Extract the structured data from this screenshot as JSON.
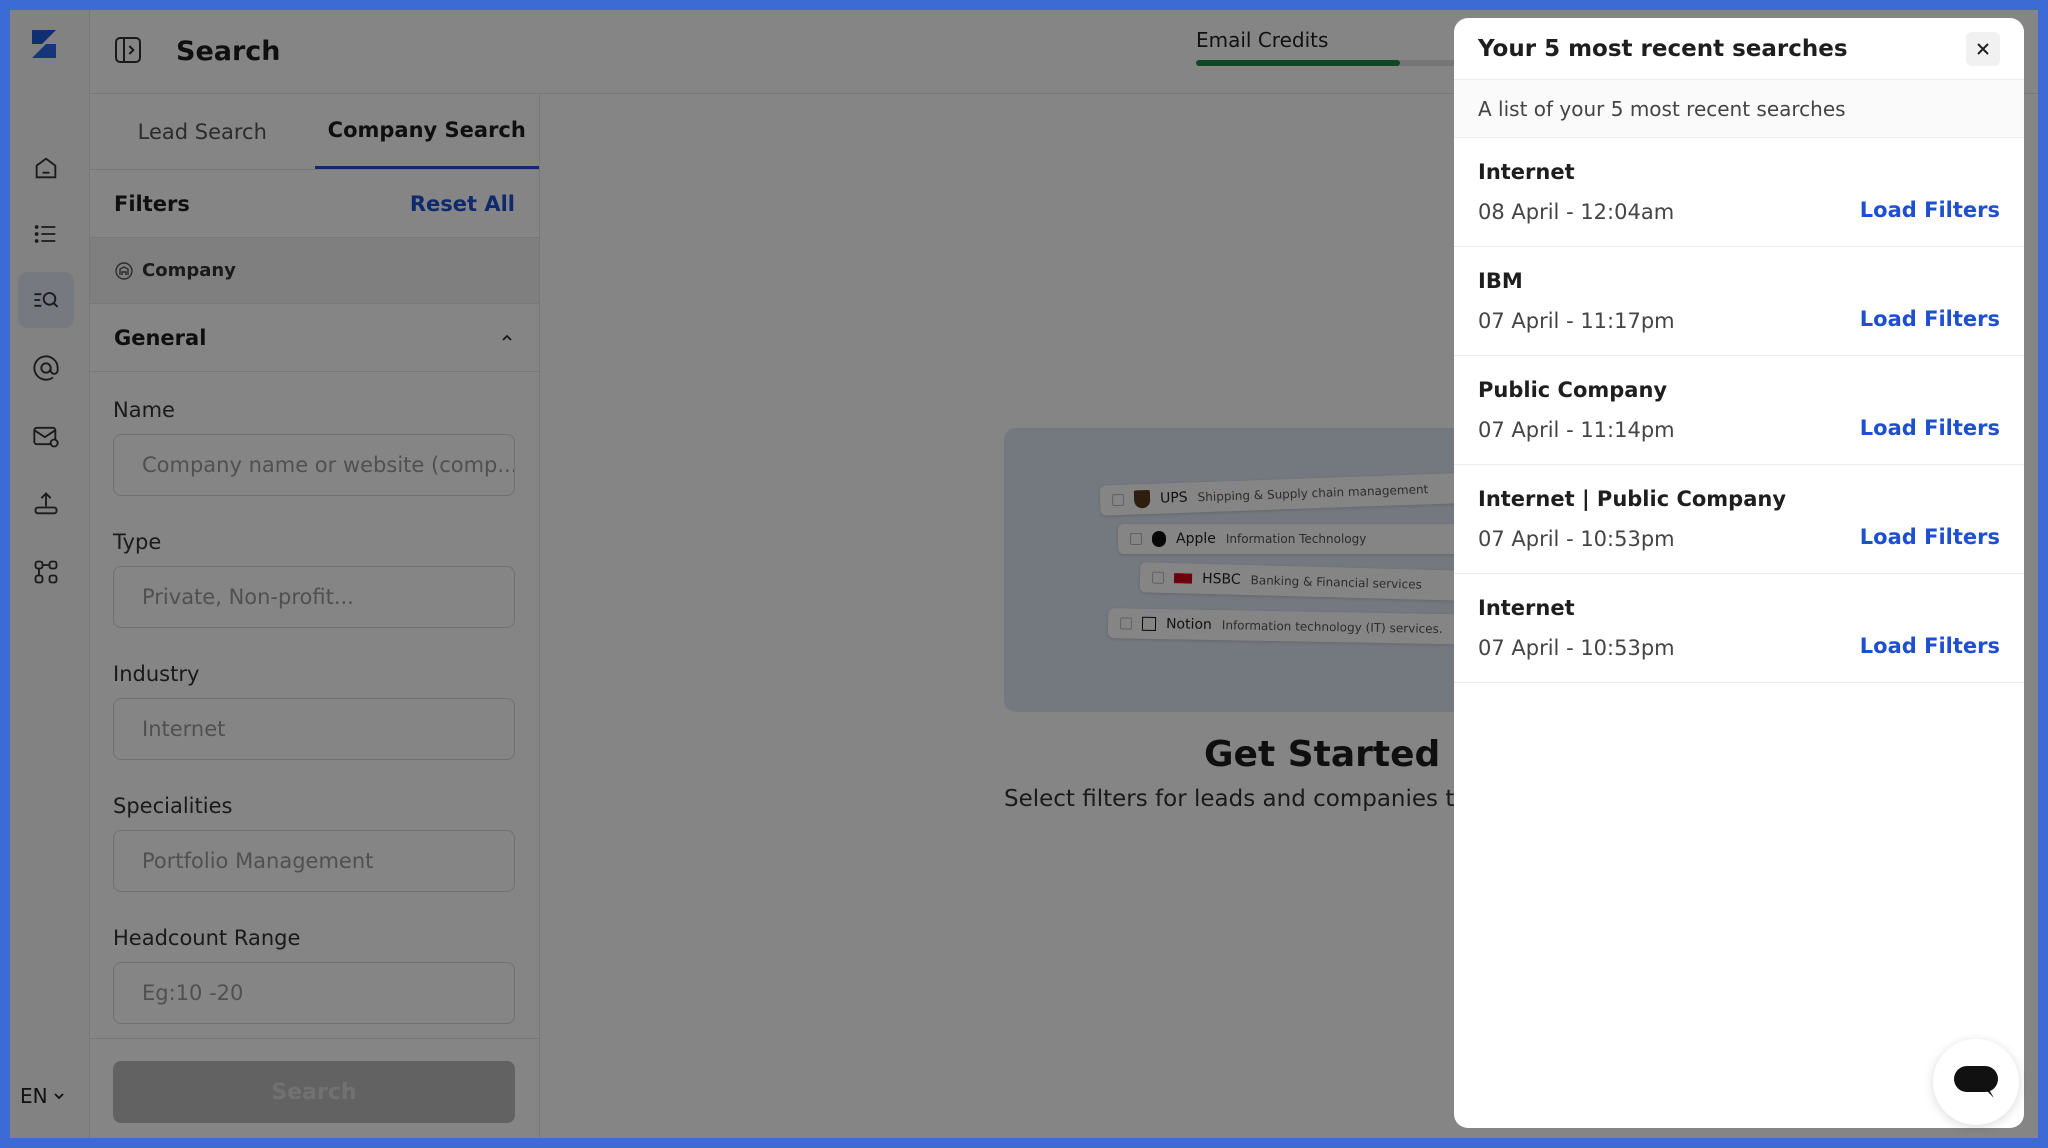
{
  "app": {
    "title": "Search",
    "language": "EN"
  },
  "sidebar": {
    "items": [
      {
        "icon": "home-icon"
      },
      {
        "icon": "list-icon"
      },
      {
        "icon": "search-list-icon",
        "active": true
      },
      {
        "icon": "at-icon"
      },
      {
        "icon": "mail-icon"
      },
      {
        "icon": "upload-icon"
      },
      {
        "icon": "integrations-icon"
      }
    ]
  },
  "header": {
    "credits_label": "Email Credits",
    "credits_fraction": 0.68
  },
  "panel": {
    "tabs": [
      {
        "label": "Lead Search"
      },
      {
        "label": "Company Search"
      }
    ],
    "filters_label": "Filters",
    "reset_label": "Reset All",
    "company_label": "Company",
    "general_label": "General",
    "fields": [
      {
        "label": "Name",
        "placeholder": "Company name or website (comp..."
      },
      {
        "label": "Type",
        "placeholder": "Private, Non-profit..."
      },
      {
        "label": "Industry",
        "placeholder": "Internet"
      },
      {
        "label": "Specialities",
        "placeholder": "Portfolio Management"
      },
      {
        "label": "Headcount Range",
        "placeholder": "Eg:10 -20"
      }
    ],
    "search_button": "Search"
  },
  "main": {
    "illustration_rows": [
      {
        "name": "UPS",
        "description": "Shipping & Supply chain management"
      },
      {
        "name": "Apple",
        "description": "Information Technology"
      },
      {
        "name": "HSBC",
        "description": "Banking & Financial services"
      },
      {
        "name": "Notion",
        "description": "Information technology (IT) services."
      }
    ],
    "heading": "Get Started",
    "subtitle": "Select filters for leads and companies to di"
  },
  "drawer": {
    "title": "Your 5 most recent searches",
    "subtitle": "A list of your 5 most recent searches",
    "load_label": "Load Filters",
    "searches": [
      {
        "query": "Internet",
        "date": "08 April - 12:04am"
      },
      {
        "query": "IBM",
        "date": "07 April - 11:17pm"
      },
      {
        "query": "Public Company",
        "date": "07 April - 11:14pm"
      },
      {
        "query": "Internet | Public Company",
        "date": "07 April - 10:53pm"
      },
      {
        "query": "Internet",
        "date": "07 April - 10:53pm"
      }
    ]
  },
  "colors": {
    "accent": "#1e4fd0",
    "credits_bar": "#1f8a4c",
    "frame": "#3d6bd6"
  }
}
